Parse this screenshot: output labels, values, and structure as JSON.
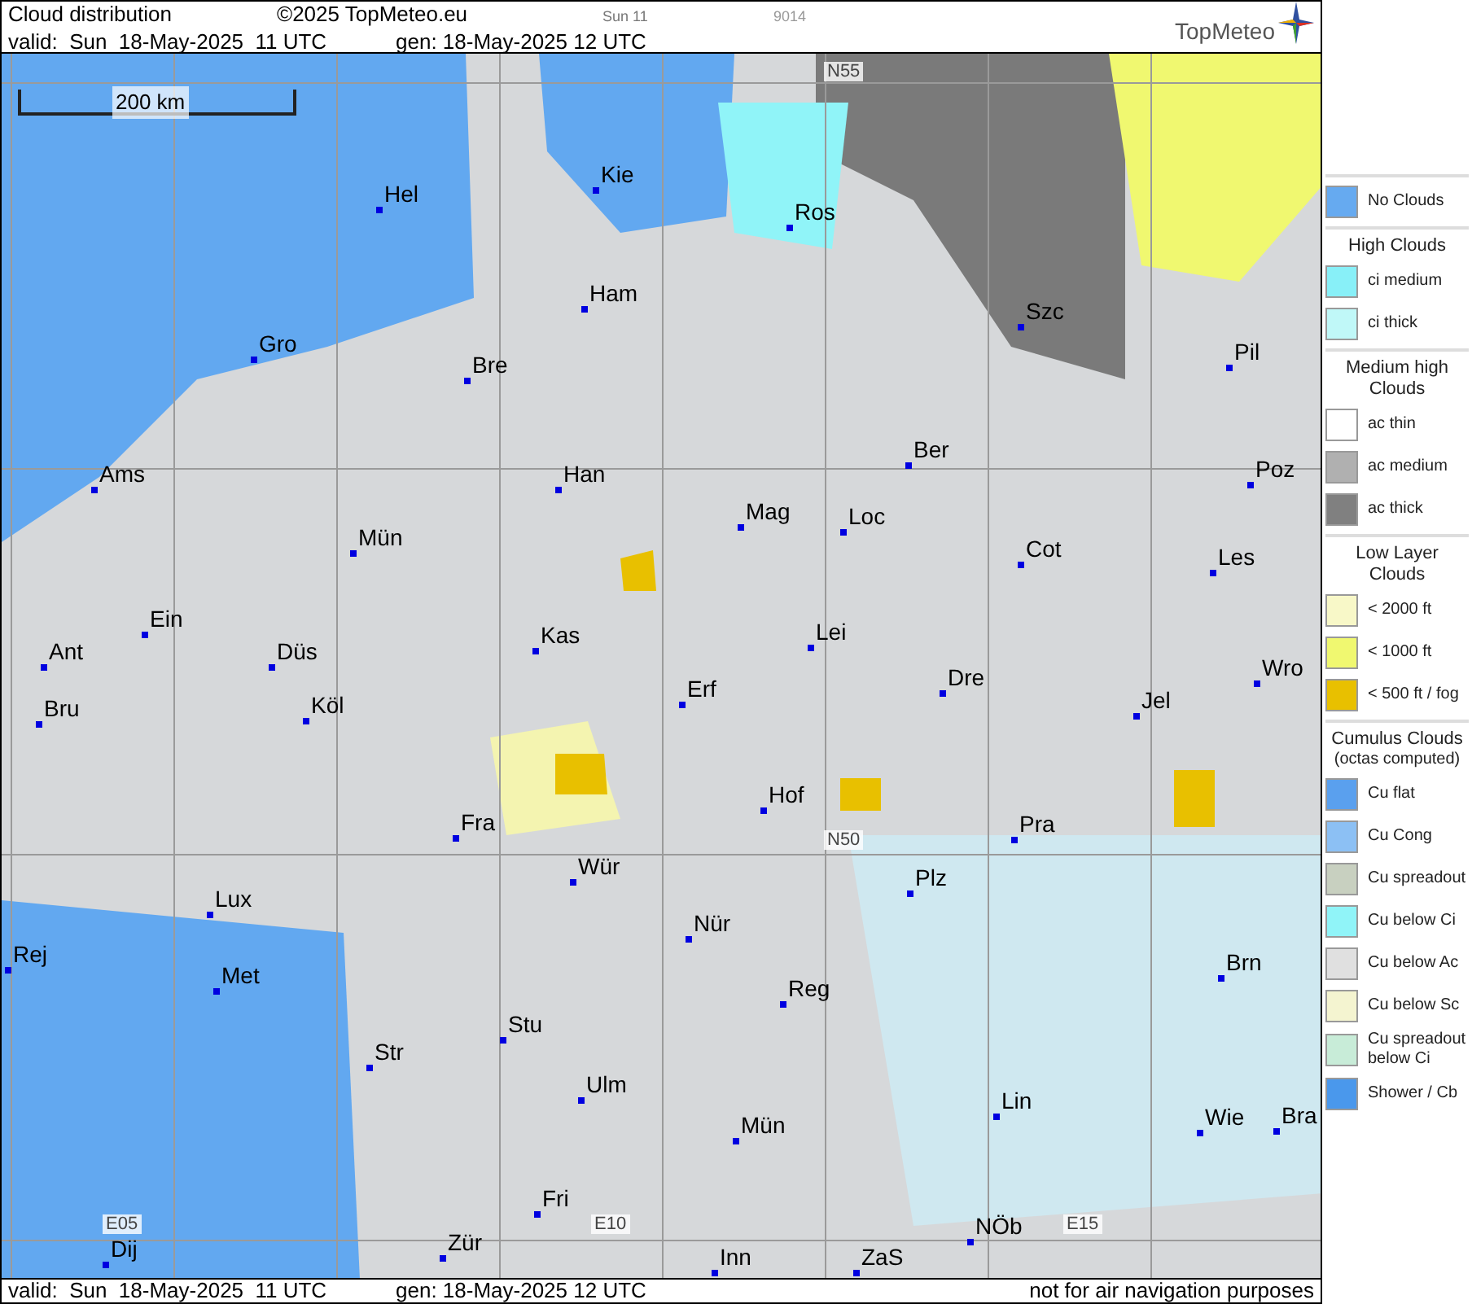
{
  "header": {
    "title": "Cloud distribution",
    "copyright": "©2025 TopMeteo.eu",
    "run": "Sun 11",
    "code": "9014",
    "valid": "valid:  Sun  18-May-2025  11 UTC",
    "generated": "gen: 18-May-2025 12 UTC",
    "logo": "TopMeteo"
  },
  "map": {
    "scale": "200 km",
    "grid_labels": [
      "N55",
      "N50",
      "E05",
      "E10",
      "E15"
    ],
    "cities": [
      {
        "name": "Hel"
      },
      {
        "name": "Kie"
      },
      {
        "name": "Ros"
      },
      {
        "name": "Ham"
      },
      {
        "name": "Szc"
      },
      {
        "name": "Gro"
      },
      {
        "name": "Bre"
      },
      {
        "name": "Pil"
      },
      {
        "name": "Ber"
      },
      {
        "name": "Ams"
      },
      {
        "name": "Han"
      },
      {
        "name": "Mag"
      },
      {
        "name": "Loc"
      },
      {
        "name": "Poz"
      },
      {
        "name": "Cot"
      },
      {
        "name": "Les"
      },
      {
        "name": "Mün"
      },
      {
        "name": "Ein"
      },
      {
        "name": "Kas"
      },
      {
        "name": "Lei"
      },
      {
        "name": "Ant"
      },
      {
        "name": "Düs"
      },
      {
        "name": "Wro"
      },
      {
        "name": "Dre"
      },
      {
        "name": "Erf"
      },
      {
        "name": "Bru"
      },
      {
        "name": "Köl"
      },
      {
        "name": "Jel"
      },
      {
        "name": "Hof"
      },
      {
        "name": "Fra"
      },
      {
        "name": "Pra"
      },
      {
        "name": "Wür"
      },
      {
        "name": "Plz"
      },
      {
        "name": "Lux"
      },
      {
        "name": "Nür"
      },
      {
        "name": "Rej"
      },
      {
        "name": "Met"
      },
      {
        "name": "Brn"
      },
      {
        "name": "Reg"
      },
      {
        "name": "Stu"
      },
      {
        "name": "Str"
      },
      {
        "name": "Ulm"
      },
      {
        "name": "Lin"
      },
      {
        "name": "Wie"
      },
      {
        "name": "Bra"
      },
      {
        "name": "Mün"
      },
      {
        "name": "Fri"
      },
      {
        "name": "NÖb"
      },
      {
        "name": "Dij"
      },
      {
        "name": "Zür"
      },
      {
        "name": "Inn"
      },
      {
        "name": "ZaS"
      }
    ]
  },
  "legend": [
    {
      "items": [
        {
          "label": "No Clouds",
          "color": "#66aaf0"
        }
      ]
    },
    {
      "title": "High Clouds",
      "items": [
        {
          "label": "ci medium",
          "color": "#88f0f8"
        },
        {
          "label": "ci thick",
          "color": "#c0f8f8"
        }
      ]
    },
    {
      "title": "Medium high Clouds",
      "items": [
        {
          "label": "ac thin",
          "color": "#ffffff"
        },
        {
          "label": "ac medium",
          "color": "#b0b0b0"
        },
        {
          "label": "ac thick",
          "color": "#808080"
        }
      ]
    },
    {
      "title": "Low Layer Clouds",
      "items": [
        {
          "label": "< 2000 ft",
          "color": "#f8f8c8"
        },
        {
          "label": "< 1000 ft",
          "color": "#f0f870"
        },
        {
          "label": "< 500 ft / fog",
          "color": "#e8c000"
        }
      ]
    },
    {
      "title": "Cumulus Clouds",
      "subtitle": "(octas computed)",
      "items": [
        {
          "label": "Cu flat",
          "color": "#5aa0ee"
        },
        {
          "label": "Cu Cong",
          "color": "#8cc0f4"
        },
        {
          "label": "Cu spreadout",
          "color": "#c8d0c0"
        },
        {
          "label": "Cu below Ci",
          "color": "#90f4f8"
        },
        {
          "label": "Cu below Ac",
          "color": "#e0e0e0"
        },
        {
          "label": "Cu below Sc",
          "color": "#f4f4d0"
        },
        {
          "label": "Cu spreadout below Ci",
          "color": "#c8ecd8"
        },
        {
          "label": "Shower / Cb",
          "color": "#4a98ec"
        }
      ]
    }
  ],
  "footer": {
    "valid": "valid:  Sun  18-May-2025  11 UTC",
    "generated": "gen: 18-May-2025 12 UTC",
    "note": "not for air navigation purposes"
  }
}
